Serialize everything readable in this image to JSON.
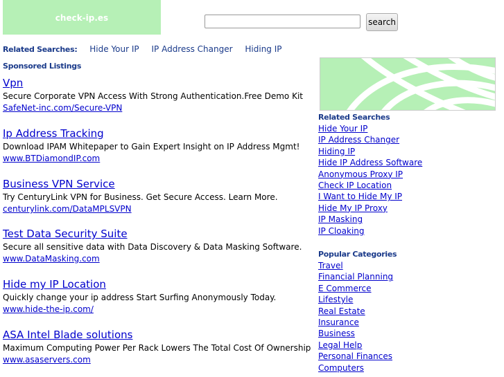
{
  "site": {
    "logo_text": "check-ip.es"
  },
  "search": {
    "placeholder": "",
    "button_label": "search"
  },
  "related_top": {
    "label": "Related Searches:",
    "links": [
      "Hide Your IP",
      "IP Address Changer",
      "Hiding IP"
    ]
  },
  "sponsored_label": "Sponsored Listings",
  "listings": [
    {
      "title": "Vpn",
      "desc": "Secure Corporate VPN Access With Strong Authentication.Free Demo Kit",
      "url": "SafeNet-inc.com/Secure-VPN"
    },
    {
      "title": "Ip Address Tracking",
      "desc": "Download IPAM Whitepaper to Gain Expert Insight on IP Address Mgmt!",
      "url": "www.BTDiamondIP.com"
    },
    {
      "title": "Business VPN Service",
      "desc": "Try CenturyLink VPN for Business. Get Secure Access. Learn More.",
      "url": "centurylink.com/DataMPLSVPN"
    },
    {
      "title": "Test Data Security Suite",
      "desc": "Secure all sensitive data with Data Discovery & Data Masking Software.",
      "url": "www.DataMasking.com"
    },
    {
      "title": "Hide my IP Location",
      "desc": "Quickly change your ip address Start Surfing Anonymously Today.",
      "url": "www.hide-the-ip.com/"
    },
    {
      "title": "ASA Intel Blade solutions",
      "desc": "Maximum Computing Power Per Rack Lowers The Total Cost Of Ownership",
      "url": "www.asaservers.com"
    }
  ],
  "sidebar": {
    "related_heading": "Related Searches",
    "related_links": [
      "Hide Your IP",
      "IP Address Changer",
      "Hiding IP",
      "Hide IP Address Software",
      "Anonymous Proxy IP",
      "Check IP Location",
      "I Want to Hide My IP",
      "Hide My IP Proxy",
      "IP Masking",
      "IP Cloaking"
    ],
    "categories_heading": "Popular Categories",
    "category_links": [
      "Travel",
      "Financial Planning",
      "E Commerce",
      "Lifestyle",
      "Real Estate",
      "Insurance",
      "Business",
      "Legal Help",
      "Personal Finances",
      "Computers"
    ]
  },
  "colors": {
    "logo_bg": "#b6f0b6",
    "link": "#0000cc",
    "heading": "#1a3a8a"
  }
}
